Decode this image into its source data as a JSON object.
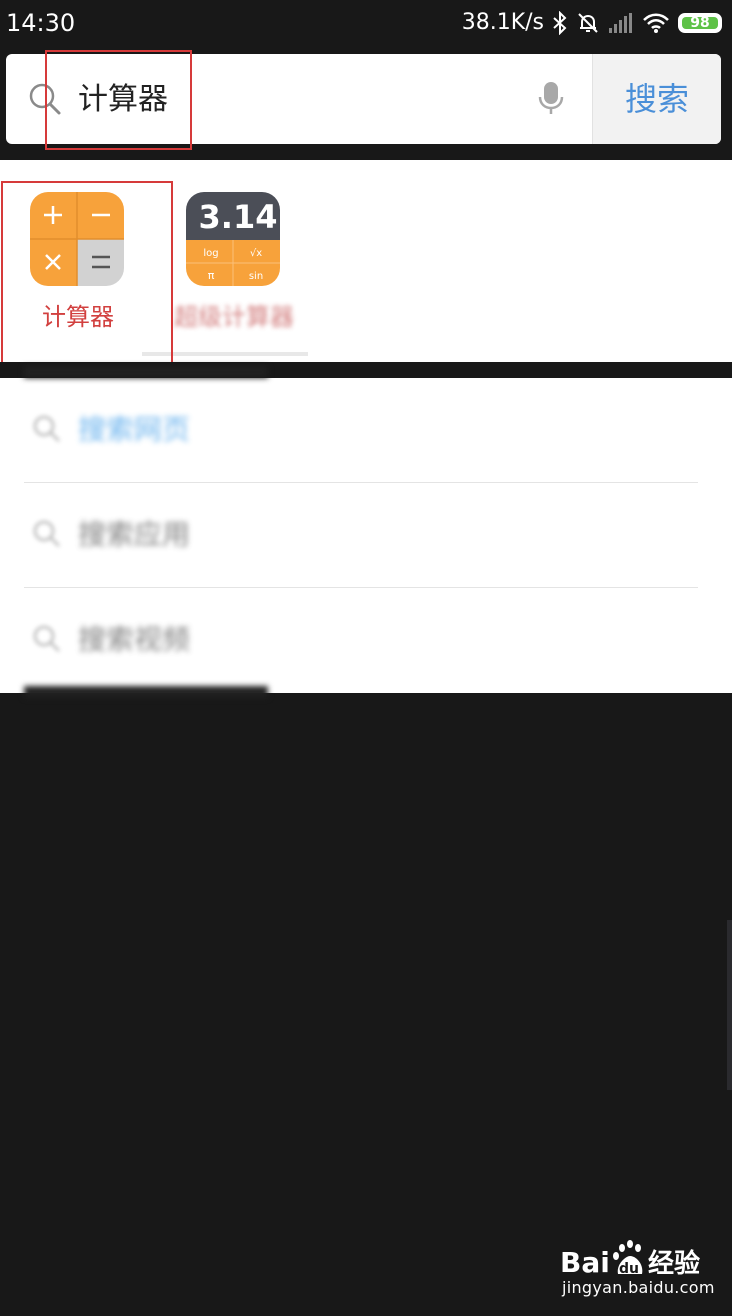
{
  "status_bar": {
    "time": "14:30",
    "net_speed": "38.1K/s",
    "battery": "98",
    "icons": [
      "bluetooth-icon",
      "alarm-off-icon",
      "signal-icon",
      "wifi-icon",
      "battery-icon"
    ]
  },
  "search": {
    "query": "计算器",
    "button_label": "搜索",
    "icons": [
      "search-icon",
      "mic-icon"
    ]
  },
  "apps": [
    {
      "label": "计算器",
      "icon": "calculator-app-icon"
    },
    {
      "label": "超级计算器",
      "icon": "pi-calculator-app-icon",
      "icon_text": "3.14",
      "keys": [
        "log",
        "√x",
        "π",
        "sin"
      ]
    }
  ],
  "suggestions": [
    {
      "label": "搜索网页"
    },
    {
      "label": "搜索应用"
    },
    {
      "label": "搜索视频"
    }
  ],
  "watermark": {
    "logo": "Bai du 经验",
    "url": "jingyan.baidu.com"
  },
  "colors": {
    "background": "#181818",
    "accent_blue": "#4a8fd8",
    "label_red": "#d2403f",
    "highlight_red": "#d63a3a",
    "calculator_orange": "#f7a23b"
  }
}
